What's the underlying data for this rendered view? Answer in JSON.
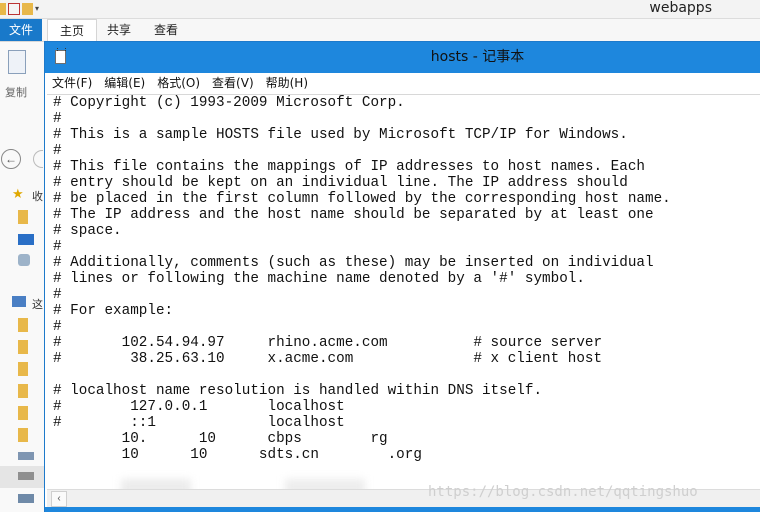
{
  "explorer": {
    "window_title": "webapps",
    "tabs": [
      "文件",
      "主页",
      "共享",
      "查看"
    ],
    "copy_label": "复制",
    "nav_labels": [
      "收",
      "这"
    ]
  },
  "notepad": {
    "title": "hosts - 记事本",
    "menu": [
      "文件(F)",
      "编辑(E)",
      "格式(O)",
      "查看(V)",
      "帮助(H)"
    ],
    "content": "# Copyright (c) 1993-2009 Microsoft Corp.\n#\n# This is a sample HOSTS file used by Microsoft TCP/IP for Windows.\n#\n# This file contains the mappings of IP addresses to host names. Each\n# entry should be kept on an individual line. The IP address should\n# be placed in the first column followed by the corresponding host name.\n# The IP address and the host name should be separated by at least one\n# space.\n#\n# Additionally, comments (such as these) may be inserted on individual\n# lines or following the machine name denoted by a '#' symbol.\n#\n# For example:\n#\n#       102.54.94.97     rhino.acme.com          # source server\n#        38.25.63.10     x.acme.com              # x client host\n\n# localhost name resolution is handled within DNS itself.\n#        127.0.0.1       localhost\n#        ::1             localhost\n        10.      10      cbps        rg\n        10      10      sdts.cn        .org"
  },
  "watermark": "https://blog.csdn.net/qqtingshuo"
}
